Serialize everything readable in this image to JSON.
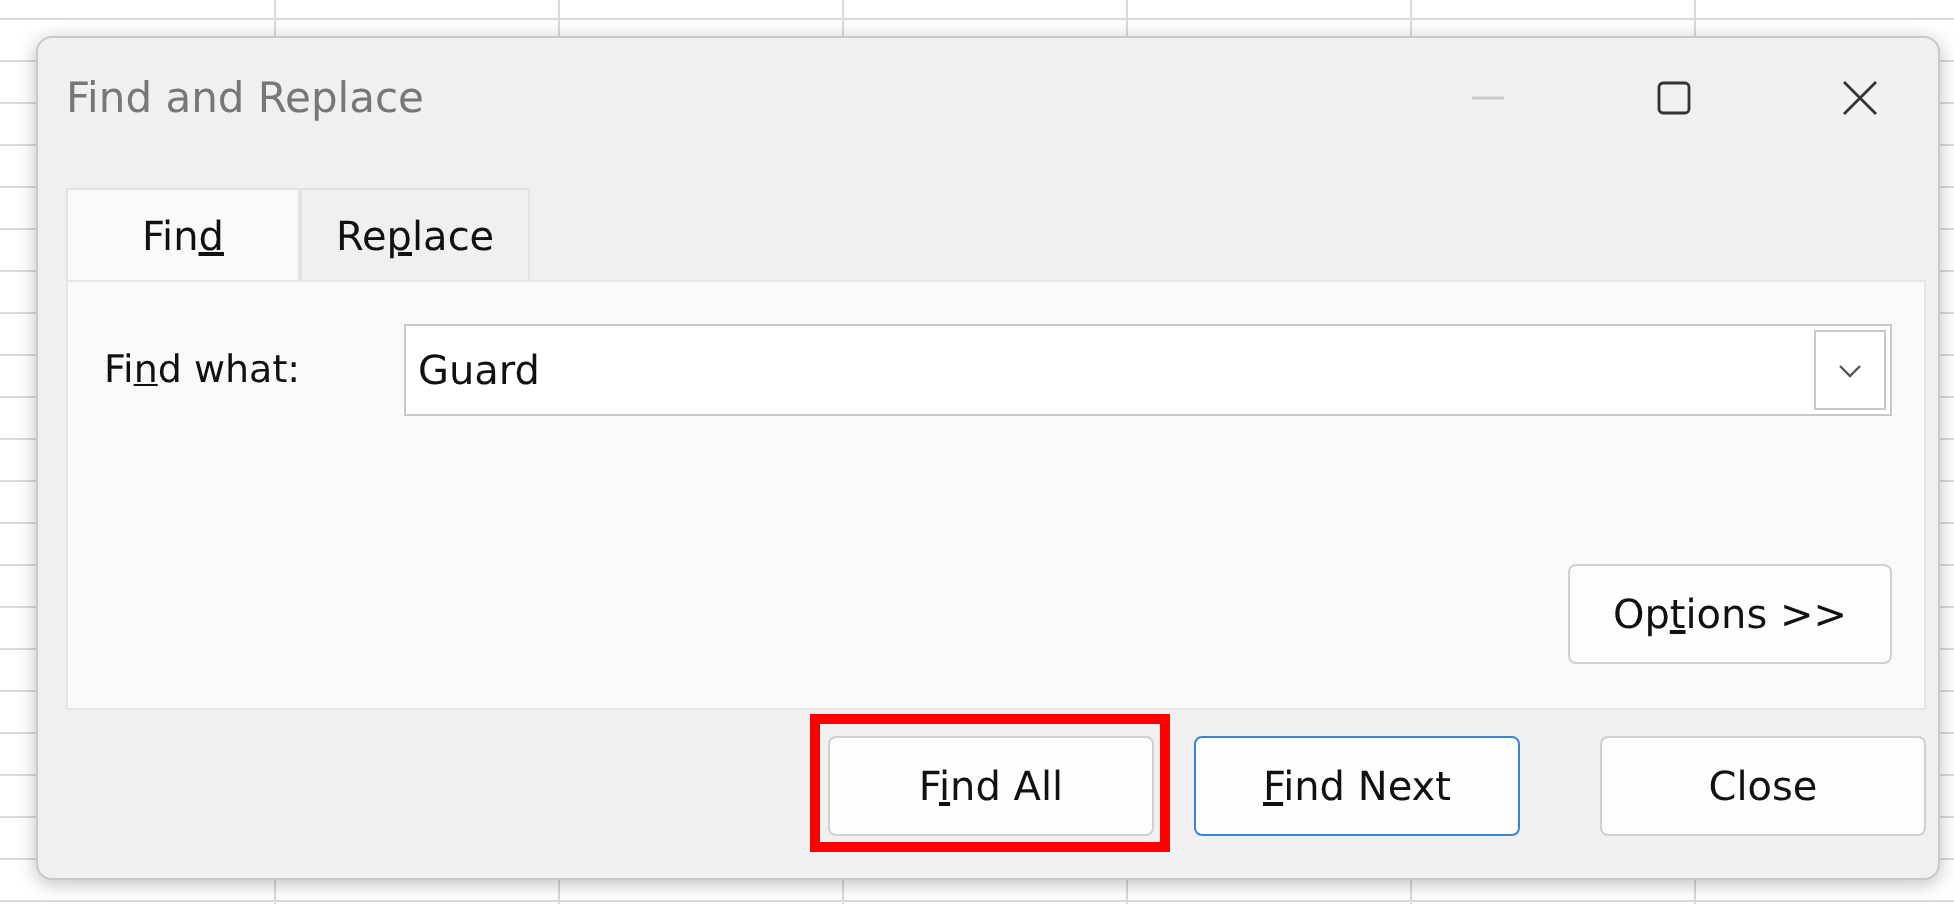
{
  "window": {
    "title": "Find and Replace",
    "controls": [
      {
        "kind": "minimize",
        "disabled": true
      },
      {
        "kind": "maximize",
        "disabled": false
      },
      {
        "kind": "close",
        "disabled": false
      }
    ]
  },
  "tabs": [
    {
      "pre": "Fin",
      "key": "d",
      "selected": true
    },
    {
      "pre": "Re",
      "key": "p",
      "post": "lace",
      "selected": false
    }
  ],
  "find_what": {
    "pre": "Fi",
    "key": "n",
    "post": "d what:",
    "value": "Guard"
  },
  "options_button": {
    "pre": "Op",
    "key": "t",
    "post": "ions >>"
  },
  "buttons": [
    {
      "pre": "F",
      "key": "i",
      "post": "nd All",
      "default": false,
      "highlighted": true
    },
    {
      "key": "F",
      "post": "ind Next",
      "default": true,
      "highlighted": false
    },
    {
      "pre": "Close",
      "default": false,
      "highlighted": false
    }
  ]
}
